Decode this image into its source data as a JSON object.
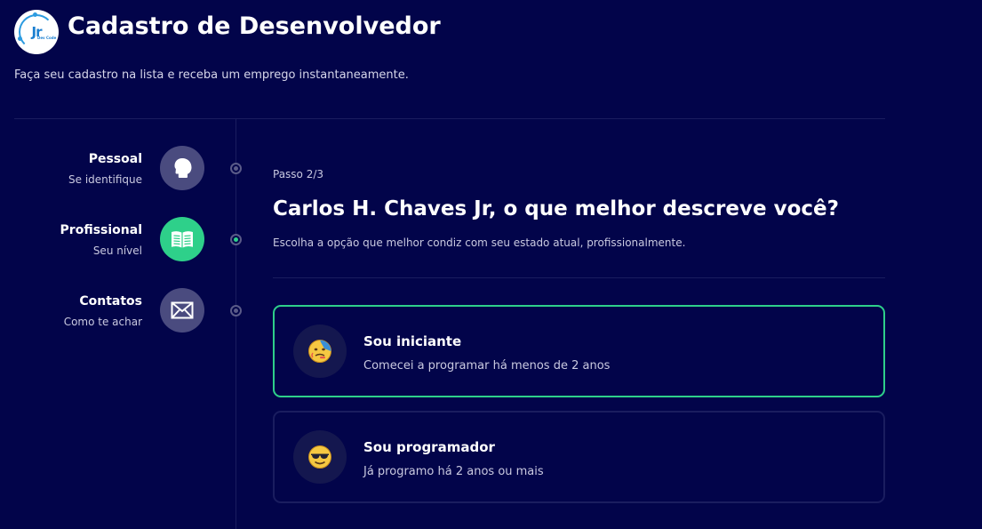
{
  "header": {
    "logo_text": "Jr",
    "logo_subtext": "Dev Code",
    "title": "Cadastro de Desenvolvedor",
    "subtitle": "Faça seu cadastro na lista e receba um emprego instantaneamente."
  },
  "steps": [
    {
      "title": "Pessoal",
      "subtitle": "Se identifique",
      "icon": "head-icon",
      "active": false
    },
    {
      "title": "Profissional",
      "subtitle": "Seu nível",
      "icon": "book-icon",
      "active": true
    },
    {
      "title": "Contatos",
      "subtitle": "Como te achar",
      "icon": "mail-icon",
      "active": false
    }
  ],
  "main": {
    "step_counter": "Passo 2/3",
    "question": "Carlos H. Chaves Jr, o que melhor descreve você?",
    "help_text": "Escolha a opção que melhor condiz com seu estado atual, profissionalmente."
  },
  "options": [
    {
      "title": "Sou iniciante",
      "description": "Comecei a programar há menos de 2 anos",
      "icon": "hot-face-emoji-icon",
      "selected": true
    },
    {
      "title": "Sou programador",
      "description": "Já programo há 2 anos ou mais",
      "icon": "sunglasses-face-emoji-icon",
      "selected": false
    }
  ],
  "colors": {
    "background": "#02044a",
    "accent": "#2ed08a",
    "inactive_icon": "#4a4b7f",
    "divider": "#1a1d5f"
  }
}
